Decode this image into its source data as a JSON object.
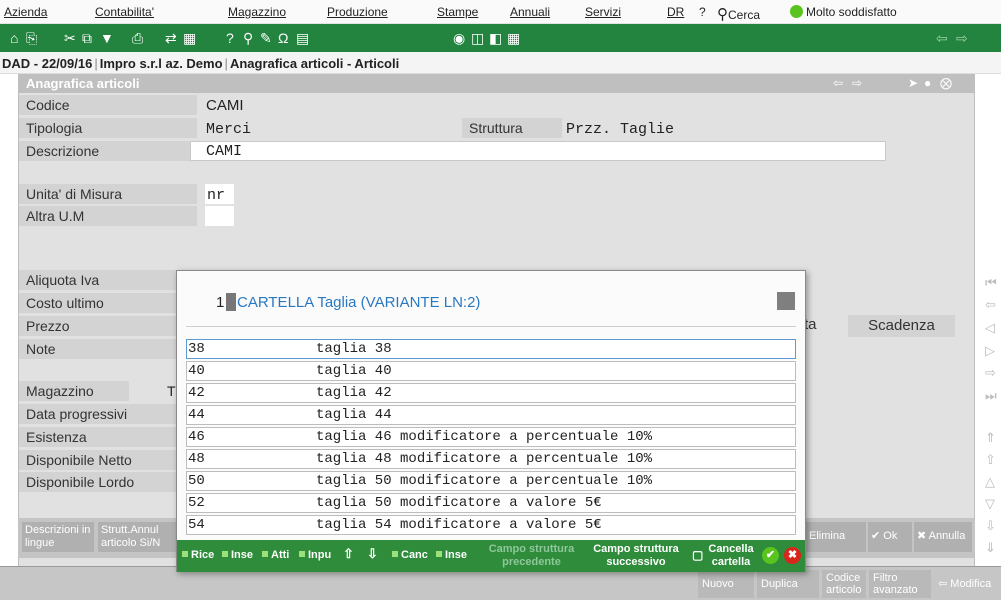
{
  "menu": [
    "Azienda",
    "Contabilita'",
    "Magazzino",
    "Produzione",
    "Stampe",
    "Annuali",
    "Servizi",
    "DR",
    "?",
    "Cerca",
    "Molto soddisfatto"
  ],
  "breadcrumb": [
    "DAD - 22/09/16",
    "Impro s.r.l az. Demo",
    "Anagrafica articoli - Articoli"
  ],
  "panel_title": "Anagrafica articoli",
  "form": {
    "codice_label": "Codice",
    "codice": "CAMI",
    "tipologia_label": "Tipologia",
    "tipologia": "Merci",
    "struttura_label": "Struttura",
    "struttura": "Przz. Taglie",
    "descrizione_label": "Descrizione",
    "descrizione": "CAMI",
    "um_label": "Unita' di Misura",
    "um": "nr",
    "altra_um_label": "Altra U.M",
    "aliquota_label": "Aliquota Iva",
    "costo_label": "Costo ultimo",
    "prezzo_label": "Prezzo",
    "note_label": "Note",
    "magazzino_label": "Magazzino",
    "magazzino_partial": "T",
    "data_prog_label": "Data progressivi",
    "esistenza_label": "Esistenza",
    "disp_netto_label": "Disponibile Netto",
    "disp_lordo_label": "Disponibile Lordo",
    "scadenza": "Scadenza",
    "partial_ta": "ta"
  },
  "bottom_buttons": [
    "Descrizioni in lingue",
    "Strutt.Annul articolo Si/N",
    "Elimina",
    "Ok",
    "Annulla"
  ],
  "os_buttons": [
    "Nuovo",
    "Duplica",
    "Codice articolo",
    "Filtro avanzato",
    "Modifica"
  ],
  "dialog": {
    "number": "1",
    "title": "CARTELLA Taglia (VARIANTE LN:2)",
    "rows": [
      {
        "code": "38",
        "desc": "taglia 38"
      },
      {
        "code": "40",
        "desc": "taglia 40"
      },
      {
        "code": "42",
        "desc": "taglia 42"
      },
      {
        "code": "44",
        "desc": "taglia 44"
      },
      {
        "code": "46",
        "desc": "taglia 46 modificatore a percentuale 10%"
      },
      {
        "code": "48",
        "desc": "taglia 48 modificatore a percentuale 10%"
      },
      {
        "code": "50",
        "desc": "taglia 50 modificatore a percentuale 10%"
      },
      {
        "code": "52",
        "desc": "taglia 50 modificatore a valore 5€"
      },
      {
        "code": "54",
        "desc": "taglia 54 modificatore a valore 5€"
      }
    ],
    "toolbar": {
      "rice": "Rice",
      "inse": "Inse",
      "atti": "Atti",
      "inpu": "Inpu",
      "canc": "Canc",
      "inse2": "Inse",
      "campo_prec": "Campo struttura precedente",
      "campo_succ_1": "Campo struttura",
      "campo_succ_2": "successivo",
      "cancella_1": "Cancella",
      "cancella_2": "cartella"
    }
  },
  "colors": {
    "toolbar_green": "#23843f",
    "title_blue": "#2a78c0",
    "ok_green": "#5ac41f",
    "cancel_red": "#d9261c"
  }
}
